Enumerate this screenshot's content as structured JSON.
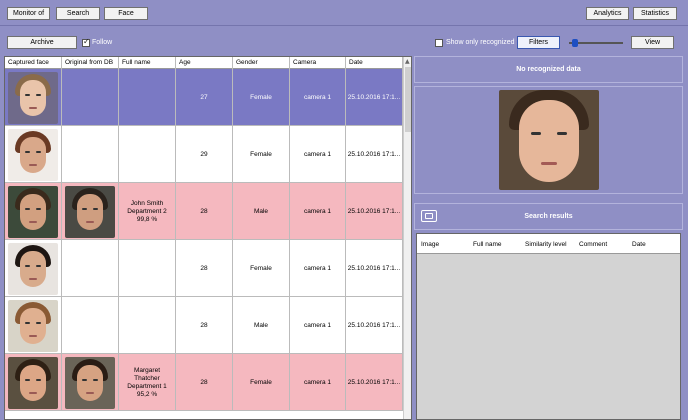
{
  "topbar": {
    "monitor_label": "Monitor of",
    "search_label": "Search",
    "face_label": "Face",
    "analytics_label": "Analytics",
    "statistics_label": "Statistics"
  },
  "toolbar": {
    "archive_label": "Archive",
    "follow_label": "Follow",
    "follow_checked": true,
    "show_only_recognized_label": "Show only recognized",
    "show_only_recognized_checked": false,
    "filters_label": "Filters",
    "view_label": "View"
  },
  "table": {
    "columns": [
      "Captured face",
      "Original from DB",
      "Full name",
      "Age",
      "Gender",
      "Camera",
      "Date"
    ],
    "rows": [
      {
        "state": "selected",
        "db_face": false,
        "name": [
          "",
          "",
          ""
        ],
        "age": "27",
        "gender": "Female",
        "camera": "camera 1",
        "date": "25.10.2016 17:1..."
      },
      {
        "state": "normal",
        "db_face": false,
        "name": [
          "",
          "",
          ""
        ],
        "age": "29",
        "gender": "Female",
        "camera": "camera 1",
        "date": "25.10.2016 17:1..."
      },
      {
        "state": "match",
        "db_face": true,
        "name": [
          "John Smith",
          "Department 2",
          "99,8 %"
        ],
        "age": "28",
        "gender": "Male",
        "camera": "camera 1",
        "date": "25.10.2016 17:1..."
      },
      {
        "state": "normal",
        "db_face": false,
        "name": [
          "",
          "",
          ""
        ],
        "age": "28",
        "gender": "Female",
        "camera": "camera 1",
        "date": "25.10.2016 17:1..."
      },
      {
        "state": "normal",
        "db_face": false,
        "name": [
          "",
          "",
          ""
        ],
        "age": "28",
        "gender": "Male",
        "camera": "camera 1",
        "date": "25.10.2016 17:1..."
      },
      {
        "state": "match",
        "db_face": true,
        "name": [
          "Margaret",
          "Thatcher",
          "Department 1",
          "95,2 %"
        ],
        "age": "28",
        "gender": "Female",
        "camera": "camera 1",
        "date": "25.10.2016 17:1..."
      }
    ]
  },
  "recognized_panel": {
    "title": "No recognized data"
  },
  "search_results": {
    "title": "Search results",
    "columns": [
      "Image",
      "Full name",
      "Similarity level",
      "Comment",
      "Date"
    ]
  },
  "colors": {
    "background": "#8f8fc5",
    "selected_row": "#7a79c4",
    "match_row": "#f5b8bf",
    "accent": "#1e4fc2"
  }
}
